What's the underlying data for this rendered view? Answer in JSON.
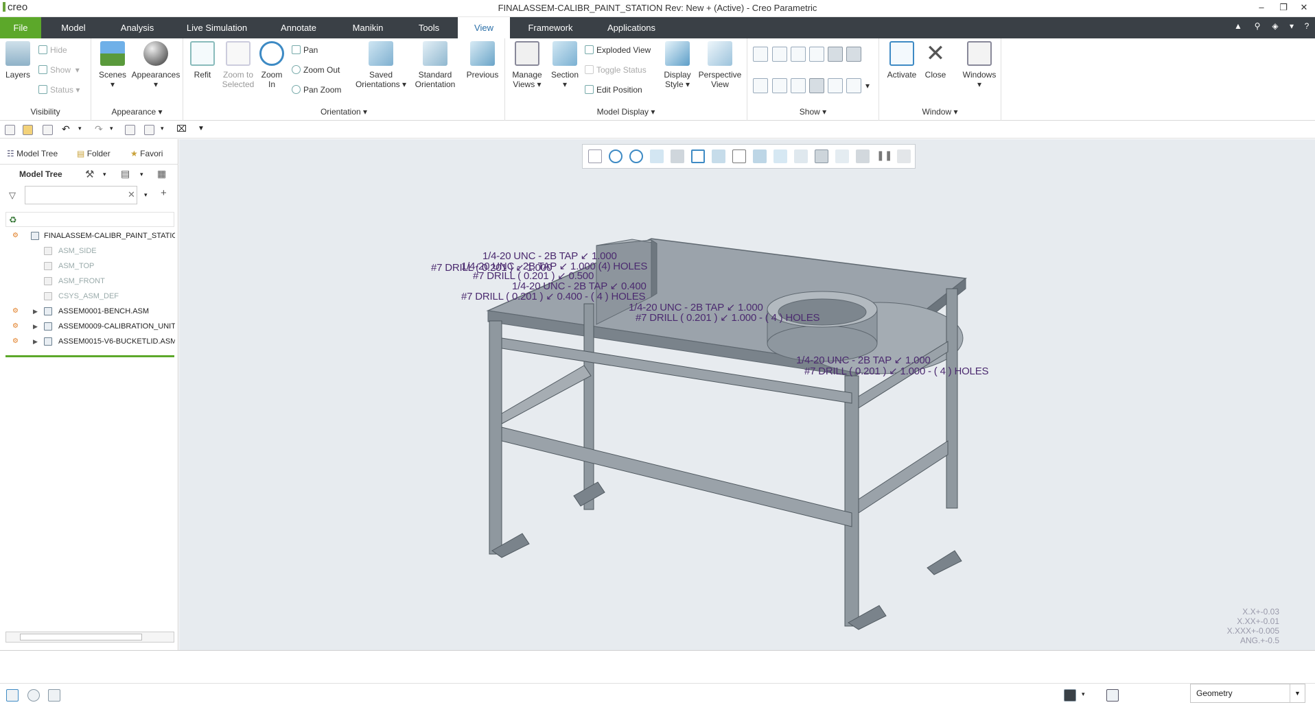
{
  "app": {
    "logo": "creo",
    "title": "FINALASSEM-CALIBR_PAINT_STATION Rev: New + (Active) - Creo Parametric"
  },
  "tabs": [
    "File",
    "Model",
    "Analysis",
    "Live Simulation",
    "Annotate",
    "Manikin",
    "Tools",
    "View",
    "Framework",
    "Applications"
  ],
  "active_tab": "View",
  "ribbon": {
    "visibility": {
      "group_label": "Visibility",
      "layers": "Layers",
      "hide": "Hide",
      "show": "Show",
      "status": "Status"
    },
    "appearance": {
      "group_label": "Appearance",
      "scenes": "Scenes",
      "appearances": "Appearances"
    },
    "orientation": {
      "group_label": "Orientation",
      "refit": "Refit",
      "zoom_to_selected": "Zoom to Selected",
      "zoom_in": "Zoom In",
      "pan": "Pan",
      "zoom_out": "Zoom Out",
      "pan_zoom": "Pan Zoom",
      "saved_orientations": "Saved Orientations",
      "standard_orientation": "Standard Orientation",
      "previous": "Previous"
    },
    "model_display": {
      "group_label": "Model Display",
      "manage_views": "Manage Views",
      "section": "Section",
      "exploded_view": "Exploded View",
      "toggle_status": "Toggle Status",
      "edit_position": "Edit Position",
      "display_style": "Display Style",
      "perspective_view": "Perspective View"
    },
    "show": {
      "group_label": "Show"
    },
    "window": {
      "group_label": "Window",
      "activate": "Activate",
      "close": "Close",
      "windows": "Windows"
    }
  },
  "left_panel": {
    "tabs": [
      "Model Tree",
      "Folder",
      "Favori"
    ],
    "header": "Model Tree",
    "search_value": "",
    "tree": [
      {
        "label": "FINALASSEM-CALIBR_PAINT_STATION.A",
        "dim": false,
        "expandable": false
      },
      {
        "label": "ASM_SIDE",
        "dim": true,
        "expandable": false
      },
      {
        "label": "ASM_TOP",
        "dim": true,
        "expandable": false
      },
      {
        "label": "ASM_FRONT",
        "dim": true,
        "expandable": false
      },
      {
        "label": "CSYS_ASM_DEF",
        "dim": true,
        "expandable": false
      },
      {
        "label": "ASSEM0001-BENCH.ASM",
        "dim": false,
        "expandable": true
      },
      {
        "label": "ASSEM0009-CALIBRATION_UNIT",
        "dim": false,
        "expandable": true
      },
      {
        "label": "ASSEM0015-V6-BUCKETLID.ASM",
        "dim": false,
        "expandable": true
      }
    ]
  },
  "annotations": [
    "1/4-20 UNC - 2B TAP ↙ 1.000",
    "1/4-20 UNC - 2B TAP ↙ 1.000 (4) HOLES",
    "#7 DRILL ( 0.201 ) ↙ 1.000",
    "#7 DRILL ( 0.201 ) ↙ 0.500",
    "1/4-20 UNC - 2B TAP ↙ 0.400",
    "#7 DRILL ( 0.201 ) ↙ 0.400 - ( 4 ) HOLES",
    "1/4-20 UNC - 2B TAP ↙ 1.000",
    "#7 DRILL ( 0.201 ) ↙ 1.000 - ( 4 ) HOLES",
    "1/4-20 UNC - 2B TAP ↙ 1.000",
    "#7 DRILL ( 0.201 ) ↙ 1.000 - ( 4 ) HOLES"
  ],
  "tolerance": [
    "X.X+-0.03",
    "X.XX+-0.01",
    "X.XXX+-0.005",
    "ANG.+-0.5"
  ],
  "status": {
    "selection_filter": "Geometry"
  },
  "colors": {
    "file_tab": "#5ca82a",
    "tab_bar": "#3a4046",
    "viewport_bg": "#e7ebef",
    "annotation": "#4b2a6f"
  }
}
